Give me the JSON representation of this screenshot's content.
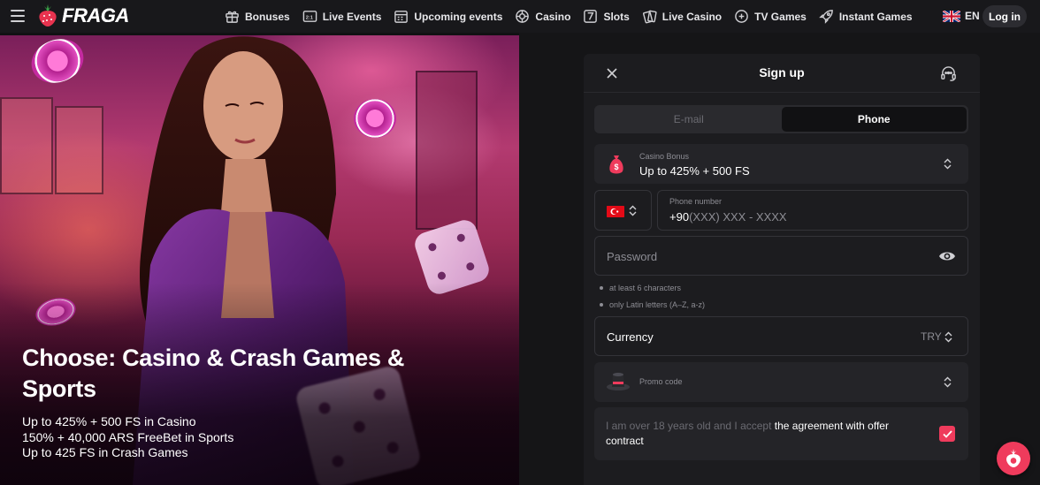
{
  "brand": {
    "name": "FRAGA",
    "accent": "#ef3b5c"
  },
  "nav": {
    "items": [
      {
        "label": "Bonuses",
        "icon": "gift-icon"
      },
      {
        "label": "Live Events",
        "icon": "live-events-icon"
      },
      {
        "label": "Upcoming events",
        "icon": "calendar-icon"
      },
      {
        "label": "Casino",
        "icon": "roulette-icon"
      },
      {
        "label": "Slots",
        "icon": "slot-seven-icon"
      },
      {
        "label": "Live Casino",
        "icon": "cards-icon"
      },
      {
        "label": "TV Games",
        "icon": "tv-games-icon"
      },
      {
        "label": "Instant Games",
        "icon": "rocket-icon"
      }
    ],
    "language": "EN",
    "login_label": "Log in"
  },
  "hero": {
    "title": "Choose: Casino & Crash Games & Sports",
    "lines": [
      "Up to 425% + 500 FS in Casino",
      "150% + 40,000 ARS FreeBet in Sports",
      "Up to 425 FS in Crash Games"
    ]
  },
  "signup": {
    "title": "Sign up",
    "tabs": [
      {
        "label": "E-mail",
        "active": false
      },
      {
        "label": "Phone",
        "active": true
      }
    ],
    "bonus": {
      "label": "Casino Bonus",
      "value": "Up to 425% + 500 FS"
    },
    "phone": {
      "label": "Phone number",
      "code": "+90",
      "mask": "(XXX) XXX - XXXX",
      "country_flag": "turkey-flag"
    },
    "password": {
      "placeholder": "Password"
    },
    "hints": [
      "at least 6 characters",
      "only Latin letters (A–Z, a-z)"
    ],
    "currency": {
      "label": "Currency",
      "value": "TRY"
    },
    "promo": {
      "placeholder": "Promo code"
    },
    "agreement": {
      "text": "I am over 18 years old and I accept ",
      "link": "the agreement with offer contract",
      "checked": true
    }
  }
}
